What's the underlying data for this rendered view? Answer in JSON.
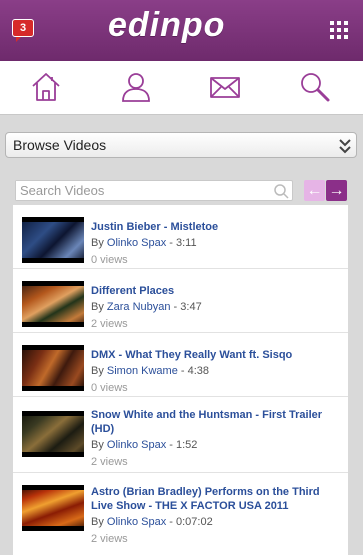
{
  "header": {
    "notification_count": "3",
    "logo_text": "edinpo",
    "brand_color": "#7a3278"
  },
  "nav": {
    "items": [
      {
        "icon": "home-icon"
      },
      {
        "icon": "user-icon"
      },
      {
        "icon": "mail-icon"
      },
      {
        "icon": "search-icon"
      }
    ]
  },
  "browse": {
    "selected": "Browse Videos"
  },
  "search": {
    "placeholder": "Search Videos",
    "value": ""
  },
  "pager": {
    "prev_glyph": "←",
    "next_glyph": "→"
  },
  "videos": [
    {
      "title": "Justin Bieber - Mistletoe",
      "by": "By",
      "author": "Olinko Spax",
      "duration": "3:11",
      "views": "0 views"
    },
    {
      "title": "Different Places",
      "by": "By",
      "author": "Zara Nubyan",
      "duration": "3:47",
      "views": "2 views"
    },
    {
      "title": "DMX - What They Really Want ft. Sisqo",
      "by": "By",
      "author": "Simon Kwame",
      "duration": "4:38",
      "views": "0 views"
    },
    {
      "title": "Snow White and the Huntsman - First Trailer (HD)",
      "by": "By",
      "author": "Olinko Spax",
      "duration": "1:52",
      "views": "2 views"
    },
    {
      "title": "Astro (Brian Bradley) Performs on the Third Live Show - THE X FACTOR USA 2011",
      "by": "By",
      "author": "Olinko Spax",
      "duration": "0:07:02",
      "views": "2 views"
    }
  ]
}
